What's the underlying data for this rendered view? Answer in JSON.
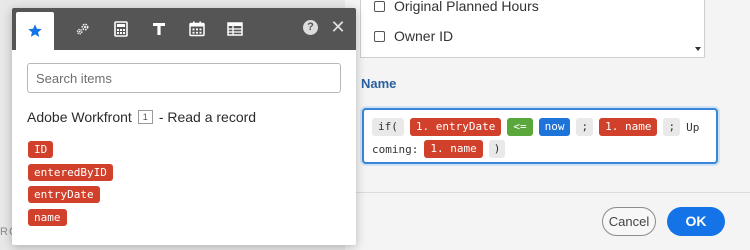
{
  "background": {
    "edge_text": "RC"
  },
  "dialog": {
    "checkbox_items": [
      {
        "label": "Original Planned Hours",
        "checked": false
      },
      {
        "label": "Owner ID",
        "checked": false
      }
    ],
    "name_label": "Name",
    "formula": {
      "line1": [
        {
          "text": "if(",
          "kind": "function"
        },
        {
          "text": "1. entryDate",
          "kind": "variable"
        },
        {
          "text": "<=",
          "kind": "operator"
        },
        {
          "text": "now",
          "kind": "keyword"
        },
        {
          "text": ";",
          "kind": "separator"
        },
        {
          "text": "1. name",
          "kind": "variable"
        },
        {
          "text": ";",
          "kind": "separator"
        },
        {
          "text": "Up",
          "kind": "text"
        }
      ],
      "line2": [
        {
          "text": "coming:",
          "kind": "text"
        },
        {
          "text": "1. name",
          "kind": "variable"
        },
        {
          "text": ")",
          "kind": "separator"
        }
      ]
    },
    "cancel_label": "Cancel",
    "ok_label": "OK"
  },
  "panel": {
    "tabs": [
      {
        "name": "favorites",
        "icon": "star-icon",
        "active": true
      },
      {
        "name": "tools",
        "icon": "gears-icon",
        "active": false
      },
      {
        "name": "math",
        "icon": "calculator-icon",
        "active": false
      },
      {
        "name": "text",
        "icon": "text-t-icon",
        "active": false
      },
      {
        "name": "date",
        "icon": "calendar-icon",
        "active": false
      },
      {
        "name": "array",
        "icon": "table-icon",
        "active": false
      }
    ],
    "help_label": "?",
    "close_label": "✕",
    "search_placeholder": "Search items",
    "module": {
      "name": "Adobe Workfront",
      "badge": "1",
      "action": "- Read a record"
    },
    "items": [
      "ID",
      "enteredByID",
      "entryDate",
      "name"
    ]
  },
  "colors": {
    "accent_blue": "#1473e6",
    "variable_red": "#d0402b",
    "operator_green": "#5aa83c",
    "keyword_blue": "#1e74d8",
    "tabbar_gray": "#555555",
    "name_label_blue": "#2c5f9e"
  }
}
